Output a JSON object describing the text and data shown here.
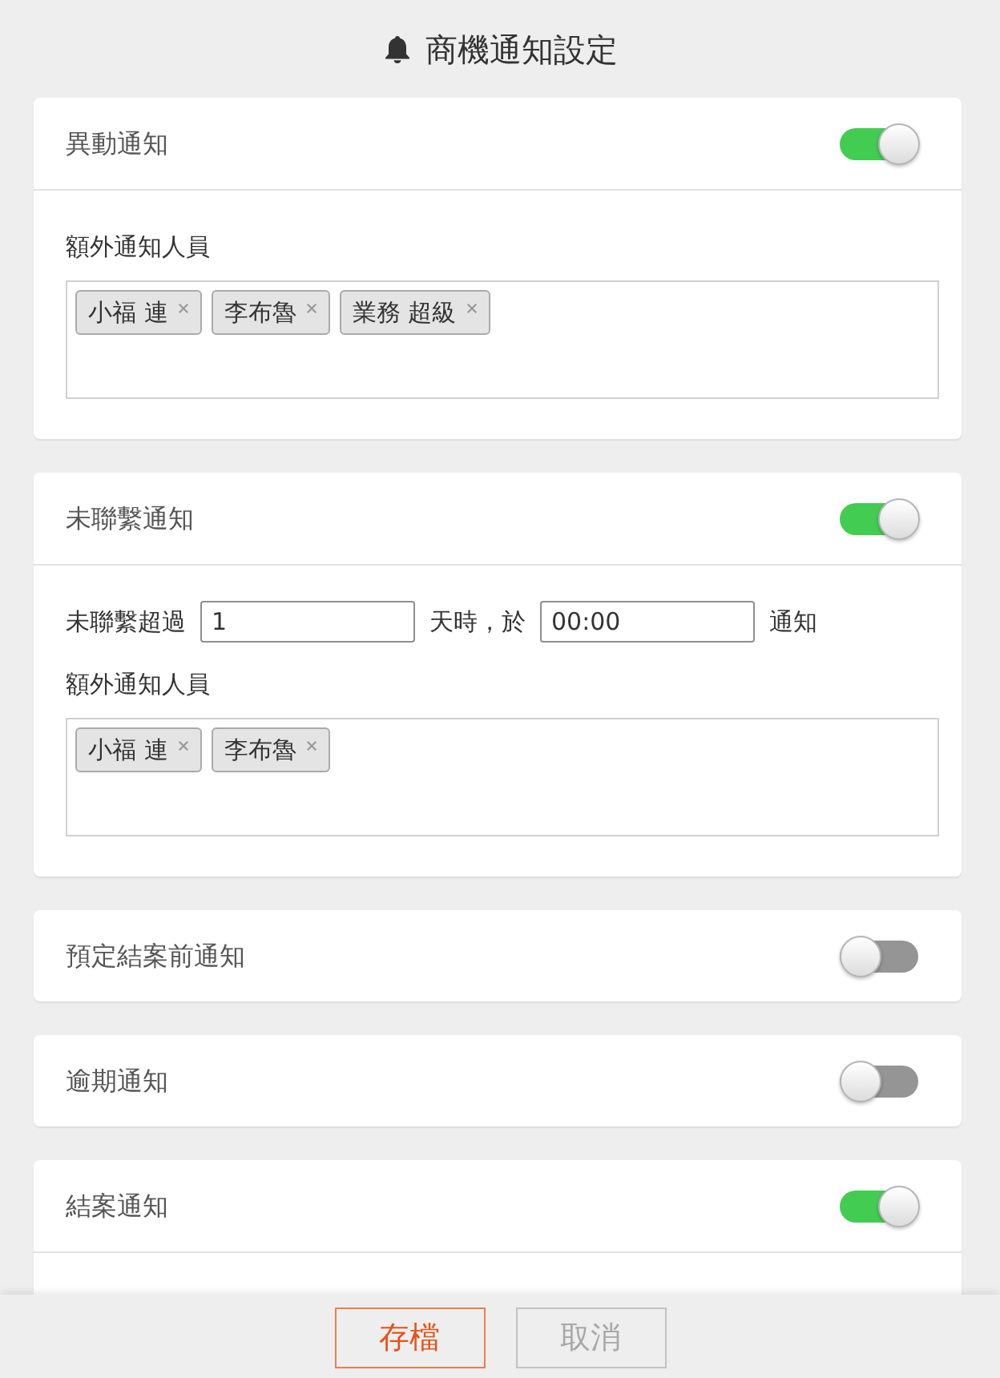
{
  "header": {
    "title": "商機通知設定"
  },
  "cards": [
    {
      "title": "異動通知",
      "enabled": true,
      "people_label": "額外通知人員",
      "people": [
        "小福 連",
        "李布魯",
        "業務 超級"
      ]
    },
    {
      "title": "未聯繫通知",
      "enabled": true,
      "rule": [
        {
          "kind": "text",
          "text": "未聯繫超過"
        },
        {
          "kind": "input",
          "value": "1"
        },
        {
          "kind": "text",
          "text": "天時，於"
        },
        {
          "kind": "input",
          "value": "00:00"
        },
        {
          "kind": "text",
          "text": "通知"
        }
      ],
      "people_label": "額外通知人員",
      "people": [
        "小福 連",
        "李布魯"
      ]
    },
    {
      "title": "預定結案前通知",
      "enabled": false
    },
    {
      "title": "逾期通知",
      "enabled": false
    },
    {
      "title": "結案通知",
      "enabled": true
    }
  ],
  "buttons": [
    {
      "label": "存檔",
      "kind": "primary"
    },
    {
      "label": "取消",
      "kind": "secondary"
    }
  ]
}
